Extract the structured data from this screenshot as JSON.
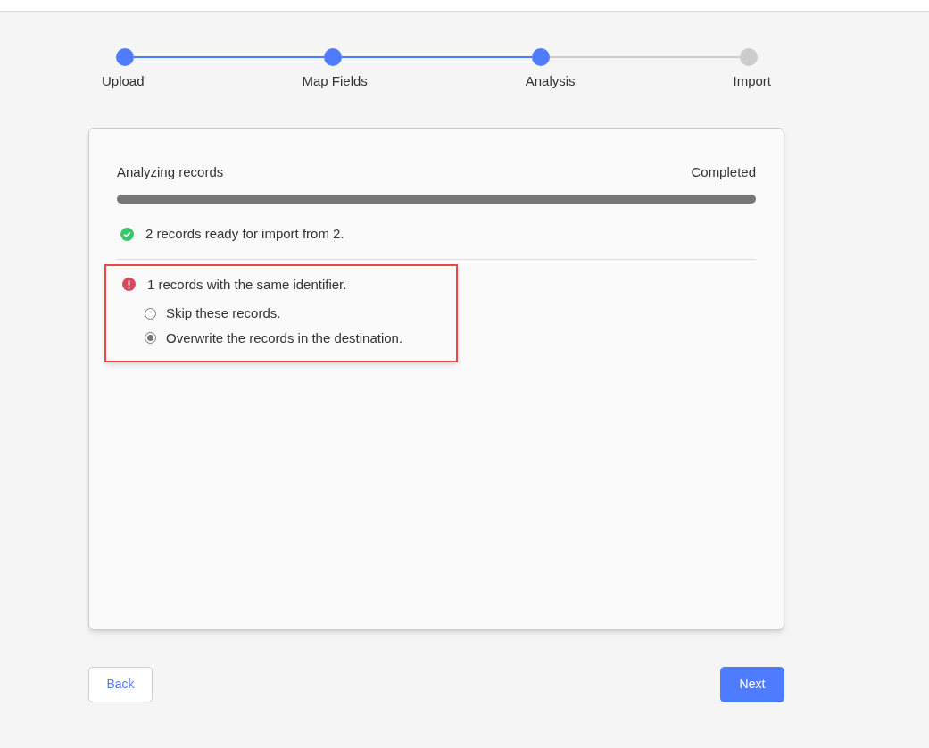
{
  "steps": [
    {
      "label": "Upload",
      "done": true
    },
    {
      "label": "Map Fields",
      "done": true
    },
    {
      "label": "Analysis",
      "done": true
    },
    {
      "label": "Import",
      "done": false
    }
  ],
  "analysis": {
    "label": "Analyzing records",
    "status": "Completed",
    "level": 1
  },
  "ready": {
    "text": "2 records ready for import from 2."
  },
  "conflict": {
    "text": "1 records with the same identifier.",
    "highlighted": true,
    "options": [
      {
        "label": "Skip these records.",
        "selected": false
      },
      {
        "label": "Overwrite the records in the destination.",
        "selected": true
      }
    ]
  },
  "buttons": {
    "back": "Back",
    "next": "Next"
  }
}
